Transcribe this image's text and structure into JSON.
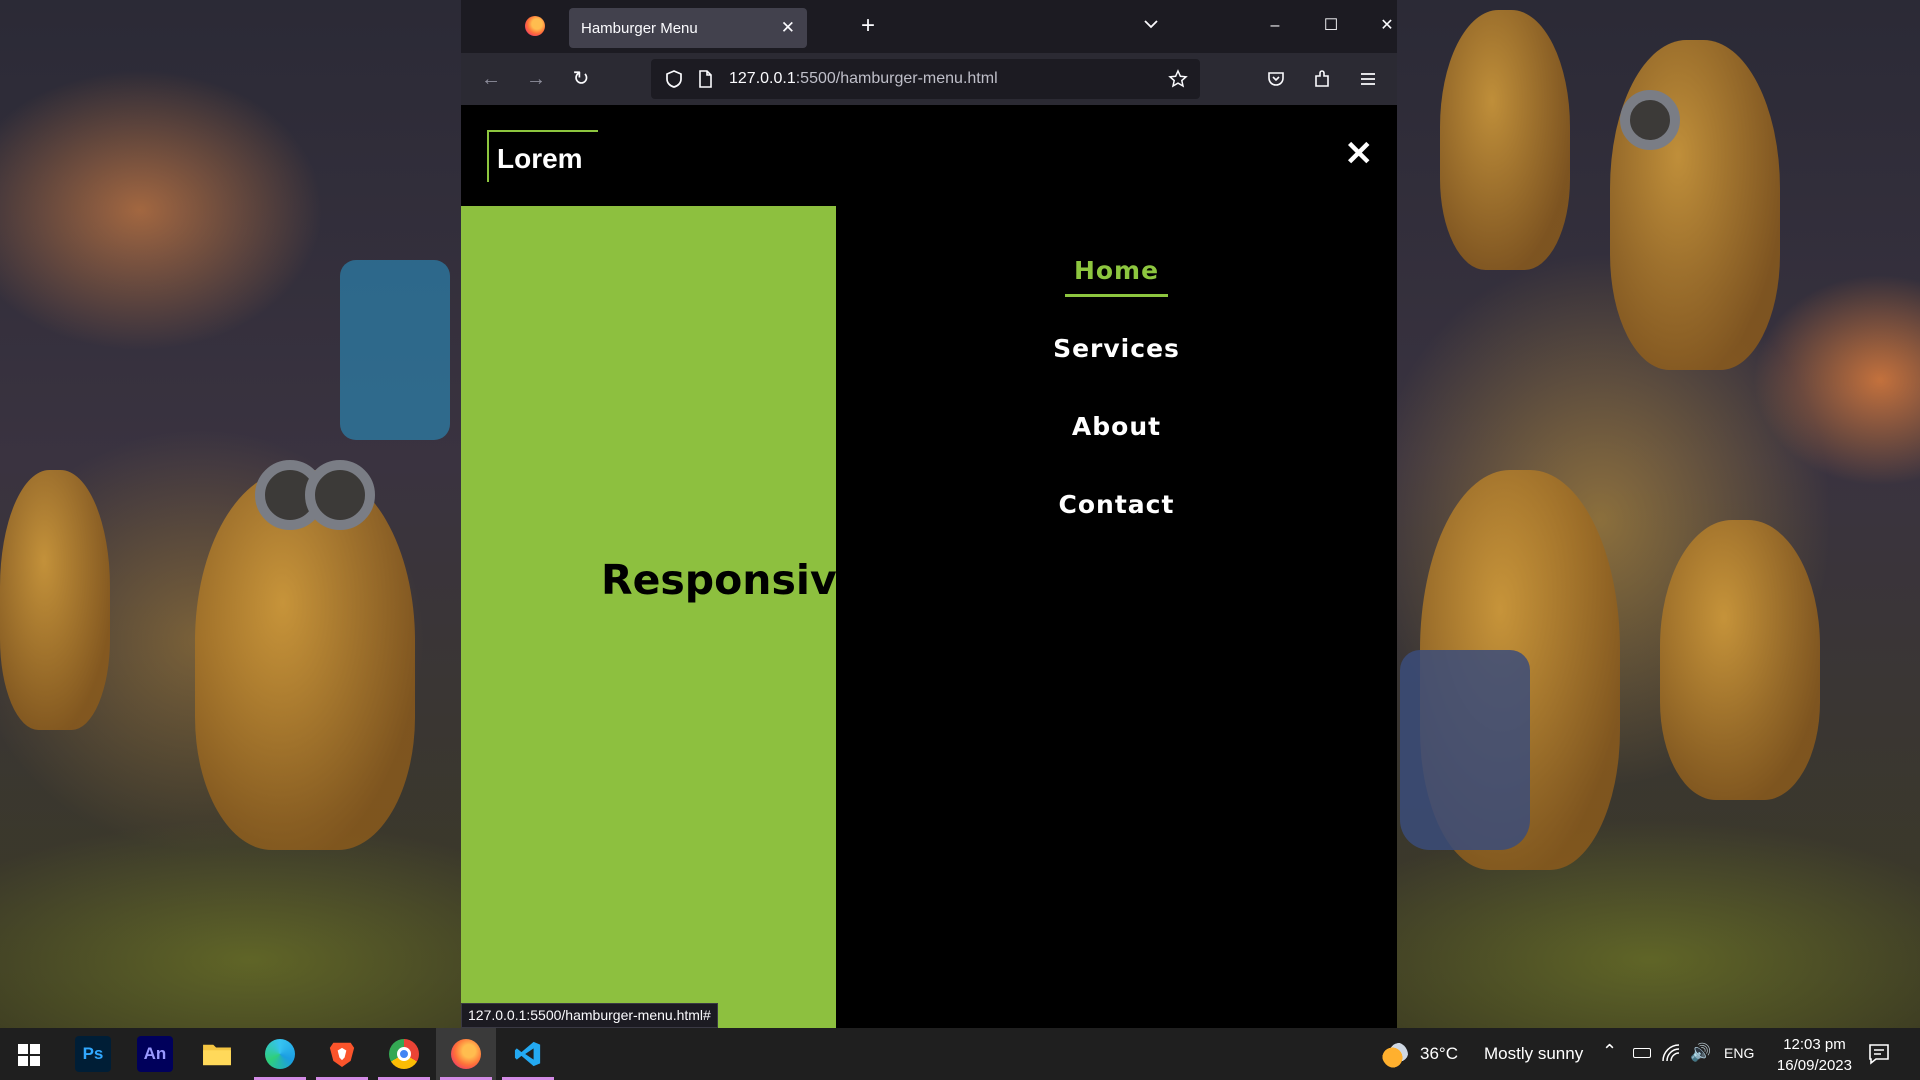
{
  "browser": {
    "tab_title": "Hamburger Menu",
    "url_host": "127.0.0.1",
    "url_rest": ":5500/hamburger-menu.html",
    "status_url": "127.0.0.1:5500/hamburger-menu.html#"
  },
  "page": {
    "logo": "Lorem",
    "close_symbol": "✕",
    "hero_text": "Responsive",
    "menu": [
      {
        "label": "Home",
        "active": true
      },
      {
        "label": "Services",
        "active": false
      },
      {
        "label": "About",
        "active": false
      },
      {
        "label": "Contact",
        "active": false
      }
    ],
    "colors": {
      "accent": "#8dc63f",
      "panel": "#8dc03f",
      "background": "#000000"
    }
  },
  "taskbar": {
    "apps": [
      "windows-start",
      "photoshop",
      "animate",
      "file-explorer",
      "edge",
      "brave",
      "chrome",
      "firefox",
      "vscode"
    ],
    "ps_label": "Ps",
    "an_label": "An",
    "weather_temp": "36°C",
    "weather_desc": "Mostly sunny",
    "language": "ENG",
    "time": "12:03 pm",
    "date": "16/09/2023"
  }
}
